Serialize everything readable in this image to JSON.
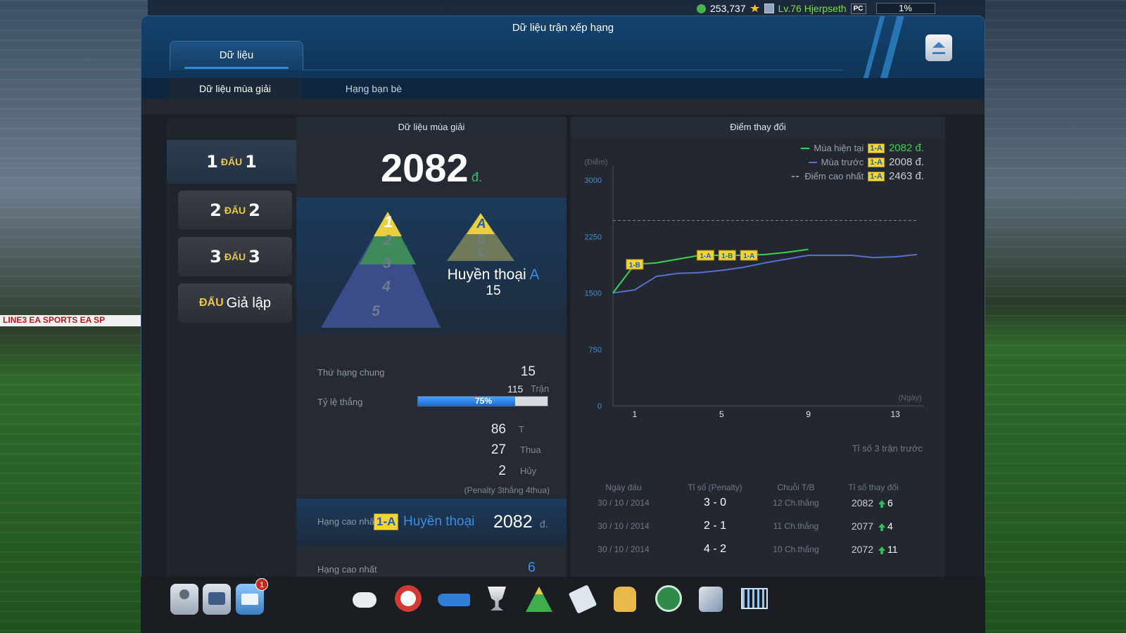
{
  "topbar": {
    "coins": "253,737",
    "level": "Lv.76 Hjerpseth",
    "platform": "PC",
    "progress": "1%"
  },
  "window": {
    "title": "Dữ liệu trận xếp hạng",
    "tab_main": "Dữ liệu"
  },
  "subtabs": {
    "season": "Dữ liệu mùa giải",
    "friends": "Hạng bạn bè"
  },
  "modes": {
    "m1": {
      "n1": "1",
      "word": "ĐẤU",
      "n2": "1"
    },
    "m2": {
      "n1": "2",
      "word": "ĐẤU",
      "n2": "2"
    },
    "m3": {
      "n1": "3",
      "word": "ĐẤU",
      "n2": "3"
    },
    "sim": {
      "word": "ĐẤU",
      "label": "Giả lập"
    }
  },
  "season": {
    "header": "Dữ liệu mùa giải",
    "score": "2082",
    "score_unit": "đ.",
    "rank_name": "Huyền thoại",
    "rank_letter": "A",
    "rank_number": "15",
    "pyramid_left": {
      "top_label": "1",
      "tiers": [
        "2",
        "3",
        "4",
        "5"
      ]
    },
    "pyramid_right": {
      "top_label": "A",
      "tiers": [
        "B",
        "C"
      ]
    },
    "overall_rank_label": "Thứ hạng chung",
    "overall_rank_value": "15",
    "matches_value": "115",
    "matches_unit": "Trận",
    "winrate_label": "Tỷ lệ thắng",
    "winrate_text": "75%",
    "winrate_fraction": 0.75,
    "wins_value": "86",
    "wins_label": "T",
    "losses_value": "27",
    "losses_label": "Thua",
    "cancel_value": "2",
    "cancel_label": "Hủy",
    "penalty_note": "(Penalty 3thắng 4thua)",
    "peak_label": "Hạng cao nhất",
    "peak_badge": "1-A",
    "peak_rank_name": "Huyền thoại",
    "peak_score": "2082",
    "peak_unit": "đ.",
    "best_label": "Hạng cao nhất",
    "best_value": "6"
  },
  "chart_panel": {
    "header": "Điểm thay đổi",
    "legend": [
      {
        "label": "Mùa hiện tại",
        "badge": "1-A",
        "value": "2082 đ.",
        "color": "#3fcf4f"
      },
      {
        "label": "Mùa trước",
        "badge": "1-A",
        "value": "2008 đ.",
        "color": "#5a6ecf"
      },
      {
        "label": "Điểm cao nhất",
        "badge": "1-A",
        "value": "2463 đ.",
        "color": "#8a8f96"
      }
    ],
    "y_unit": "(Điểm)",
    "x_unit": "(Ngày)",
    "point_badges": [
      "1-B",
      "1-A",
      "1-B",
      "1-A"
    ]
  },
  "chart_data": {
    "type": "line",
    "ylabel": "(Điểm)",
    "xlabel": "(Ngày)",
    "ylim": [
      0,
      3000
    ],
    "xlim": [
      0,
      14
    ],
    "yticks": [
      "0",
      "750",
      "1500",
      "2250",
      "3000"
    ],
    "xticks": [
      "1",
      "5",
      "9",
      "13"
    ],
    "reference_line": {
      "name": "Điểm cao nhất",
      "y": 2463
    },
    "series": [
      {
        "name": "Mùa hiện tại",
        "x": [
          0,
          1,
          2,
          3,
          4,
          5,
          6,
          7,
          8,
          9
        ],
        "y": [
          1500,
          1880,
          1900,
          1950,
          2000,
          2000,
          2000,
          2010,
          2040,
          2080
        ]
      },
      {
        "name": "Mùa trước",
        "x": [
          0,
          1,
          2,
          3,
          4,
          5,
          6,
          7,
          8,
          9,
          10,
          11,
          12,
          13,
          14
        ],
        "y": [
          1500,
          1540,
          1720,
          1760,
          1770,
          1800,
          1840,
          1900,
          1950,
          2000,
          2000,
          2000,
          1970,
          1980,
          2010
        ]
      }
    ]
  },
  "recent": {
    "title": "Tỉ số 3 trận trước",
    "headers": [
      "Ngày đấu",
      "Tỉ số (Penalty)",
      "Chuỗi T/B",
      "Tỉ số thay đổi"
    ],
    "rows": [
      {
        "date": "30 / 10 / 2014",
        "score": "3 - 0",
        "streak": "12 Ch.thắng",
        "points": "2082",
        "delta": "6"
      },
      {
        "date": "30 / 10 / 2014",
        "score": "2 - 1",
        "streak": "11 Ch.thắng",
        "points": "2077",
        "delta": "4"
      },
      {
        "date": "30 / 10 / 2014",
        "score": "4 - 2",
        "streak": "10 Ch.thắng",
        "points": "2072",
        "delta": "11"
      }
    ]
  },
  "dock": {
    "mail_badge": "1"
  },
  "background": {
    "ad_text": "LINE3  EA SPORTS  EA SP"
  }
}
